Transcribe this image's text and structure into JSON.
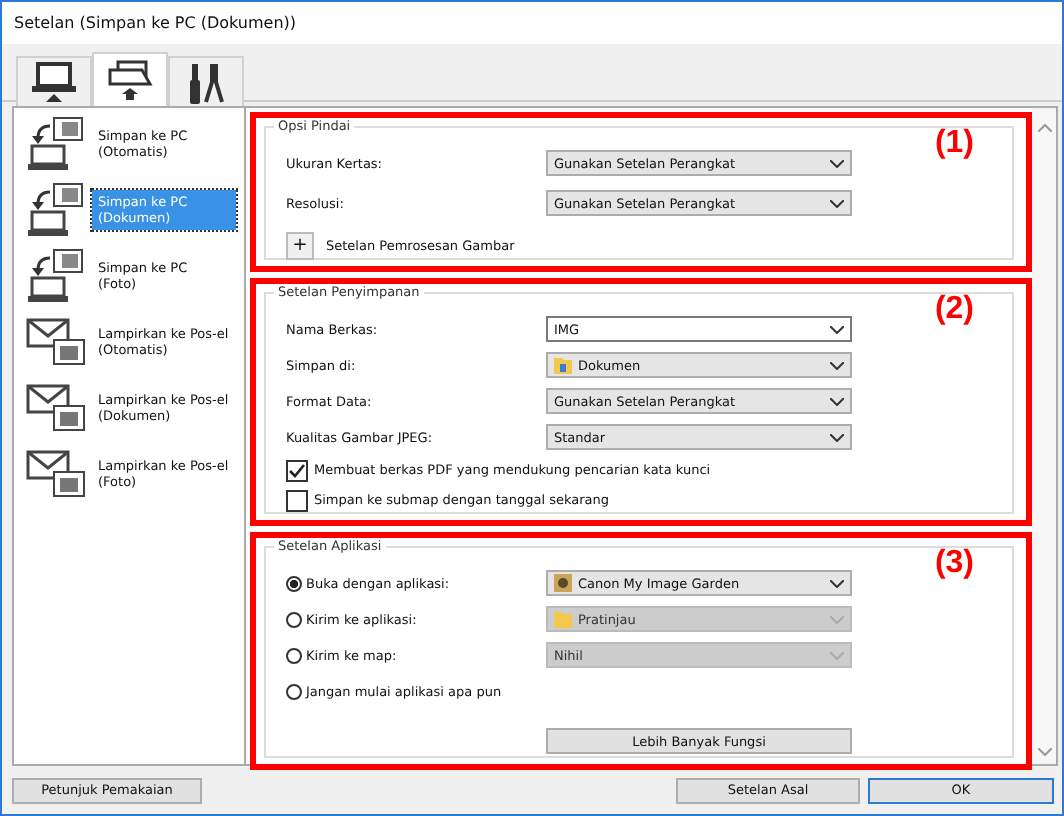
{
  "window": {
    "title": "Setelan (Simpan ke PC (Dokumen))"
  },
  "tabs": [
    {
      "kind": "computer",
      "selected": false
    },
    {
      "kind": "scanner",
      "selected": true
    },
    {
      "kind": "tools",
      "selected": false
    }
  ],
  "sidebar": {
    "items": [
      {
        "kind": "pc",
        "label": "Simpan ke PC",
        "sublabel": "(Otomatis)",
        "selected": false
      },
      {
        "kind": "pc",
        "label": "Simpan ke PC",
        "sublabel": "(Dokumen)",
        "selected": true
      },
      {
        "kind": "pc",
        "label": "Simpan ke PC",
        "sublabel": "(Foto)",
        "selected": false
      },
      {
        "kind": "email",
        "label": "Lampirkan ke Pos-el",
        "sublabel": "(Otomatis)",
        "selected": false
      },
      {
        "kind": "email",
        "label": "Lampirkan ke Pos-el",
        "sublabel": "(Dokumen)",
        "selected": false
      },
      {
        "kind": "email",
        "label": "Lampirkan ke Pos-el",
        "sublabel": "(Foto)",
        "selected": false
      }
    ]
  },
  "sections": [
    {
      "title": "Opsi Pindai",
      "annotation": "(1)",
      "rows": [
        {
          "kind": "select",
          "label": "Ukuran Kertas:",
          "value": "Gunakan Setelan Perangkat",
          "editable": false,
          "disabled": false
        },
        {
          "kind": "select",
          "label": "Resolusi:",
          "value": "Gunakan Setelan Perangkat",
          "editable": false,
          "disabled": false
        },
        {
          "kind": "expander",
          "symbol": "+",
          "label": "Setelan Pemrosesan Gambar"
        }
      ]
    },
    {
      "title": "Setelan Penyimpanan",
      "annotation": "(2)",
      "rows": [
        {
          "kind": "select",
          "label": "Nama Berkas:",
          "value": "IMG",
          "editable": true,
          "disabled": false
        },
        {
          "kind": "select",
          "label": "Simpan di:",
          "value": "Dokumen",
          "icon": {
            "kind": "folder"
          },
          "editable": false,
          "disabled": false
        },
        {
          "kind": "select",
          "label": "Format Data:",
          "value": "Gunakan Setelan Perangkat",
          "editable": false,
          "disabled": false
        },
        {
          "kind": "select",
          "label": "Kualitas Gambar JPEG:",
          "value": "Standar",
          "editable": false,
          "disabled": false
        },
        {
          "kind": "checkbox",
          "label": "Membuat berkas PDF yang mendukung pencarian kata kunci",
          "checked": true
        },
        {
          "kind": "checkbox",
          "label": "Simpan ke submap dengan tanggal sekarang",
          "checked": false
        }
      ]
    },
    {
      "title": "Setelan Aplikasi",
      "annotation": "(3)",
      "rows": [
        {
          "kind": "radio",
          "label": "Buka dengan aplikasi:",
          "selected": true,
          "value": "Canon My Image Garden",
          "icon": {
            "kind": "app"
          },
          "disabled": false
        },
        {
          "kind": "radio",
          "label": "Kirim ke aplikasi:",
          "selected": false,
          "value": "Pratinjau",
          "icon": {
            "kind": "folder"
          },
          "disabled": true
        },
        {
          "kind": "radio",
          "label": "Kirim ke map:",
          "selected": false,
          "value": "Nihil",
          "disabled": true
        },
        {
          "kind": "radio",
          "label": "Jangan mulai aplikasi apa pun",
          "selected": false
        },
        {
          "kind": "button",
          "label": "Lebih Banyak Fungsi"
        }
      ]
    }
  ],
  "footer": {
    "help_button": "Petunjuk Pemakaian",
    "default_button": "Setelan Asal",
    "ok_button": "OK"
  }
}
